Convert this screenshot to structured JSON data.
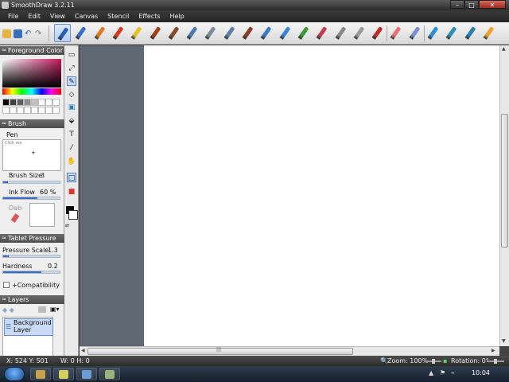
{
  "window": {
    "title": "SmoothDraw 3.2.11",
    "controls": {
      "minimize": "–",
      "maximize": "□",
      "close": "✕"
    }
  },
  "menu": [
    "File",
    "Edit",
    "View",
    "Canvas",
    "Stencil",
    "Effects",
    "Help"
  ],
  "toolbar": {
    "small_icons": [
      "open-icon",
      "save-icon",
      "undo-icon",
      "redo-icon"
    ],
    "brushes": [
      {
        "name": "pen-tool",
        "color": "#2a5fb3",
        "active": true
      },
      {
        "name": "pencil-tool",
        "color": "#3d6fc7"
      },
      {
        "name": "crayon-tool",
        "color": "#e07a20"
      },
      {
        "name": "marker-tool",
        "color": "#d83a1d"
      },
      {
        "name": "highlighter-tool",
        "color": "#e5c224"
      },
      {
        "name": "brush-tool",
        "color": "#a53f1a"
      },
      {
        "name": "paint-brush-tool",
        "color": "#8a4a23"
      },
      {
        "name": "airbrush-tool",
        "color": "#4f79b2"
      },
      {
        "name": "spray-tool",
        "color": "#7c8c9d"
      },
      {
        "name": "syringe-tool",
        "color": "#5e7fa8"
      },
      {
        "name": "ink-brush-tool",
        "color": "#8c3a2c"
      },
      {
        "name": "water-brush-tool",
        "color": "#3a7cc8"
      },
      {
        "name": "blur-tool",
        "color": "#3b86d6"
      },
      {
        "name": "grass-tool",
        "color": "#3c9a34"
      },
      {
        "name": "jigsaw-tool",
        "color": "#c04050"
      },
      {
        "name": "texture-tool",
        "color": "#8b8b8b"
      },
      {
        "name": "hatch-tool",
        "color": "#9a9a9a"
      },
      {
        "name": "stamp-tool",
        "color": "#c62828"
      },
      {
        "name": "eraser-tool",
        "color": "#e57373"
      },
      {
        "name": "soft-eraser-tool",
        "color": "#7a8fd0"
      },
      {
        "name": "water-drop-tool",
        "color": "#2f8be0"
      },
      {
        "name": "fill-tool",
        "color": "#2e8fb4"
      },
      {
        "name": "blend-tool",
        "color": "#2c7fb0"
      },
      {
        "name": "smudge-tool",
        "color": "#f0a030"
      }
    ]
  },
  "left_panel": {
    "foreground_color": {
      "title": "Foreground Color",
      "swatches_row1": [
        "#000000",
        "#404040",
        "#606060",
        "#909090",
        "#c0c0c0",
        "#ffffff",
        "#ffffff",
        "#ffffff"
      ],
      "swatches_row2": [
        "#ffffff",
        "#ffffff",
        "#ffffff",
        "#ffffff",
        "#ffffff",
        "#ffffff",
        "#ffffff",
        "#ffffff"
      ]
    },
    "brush": {
      "title": "Brush",
      "name": "Pen",
      "preview_hint": "Click me",
      "size_label": "Brush Size",
      "size_value": "3",
      "size_fraction": 0.08,
      "flow_label": "Ink Flow",
      "flow_value": "60 %",
      "flow_fraction": 0.6,
      "dab_label": "Dab"
    },
    "tablet_pressure": {
      "title": "Tablet Pressure",
      "scale_label": "Pressure Scale",
      "scale_value": "1.3",
      "scale_fraction": 0.1,
      "hardness_label": "Hardness",
      "hardness_value": "0.2",
      "hardness_fraction": 0.68,
      "compat_label": "+Compatibility"
    },
    "layers": {
      "title": "Layers",
      "items": [
        "Background\nLayer"
      ]
    }
  },
  "tools_column": [
    {
      "name": "select-rect-icon",
      "glyph": "▭"
    },
    {
      "name": "move-icon",
      "glyph": "⤢"
    },
    {
      "name": "brush-icon",
      "glyph": "✎",
      "active": true
    },
    {
      "name": "eraser-icon",
      "glyph": "◇"
    },
    {
      "name": "picture-icon",
      "glyph": "▣"
    },
    {
      "name": "fill-bucket-icon",
      "glyph": "⬙"
    },
    {
      "name": "text-icon",
      "glyph": "T"
    },
    {
      "name": "eyedropper-icon",
      "glyph": "⁄"
    },
    {
      "name": "hand-icon",
      "glyph": "✋"
    },
    {
      "name": "rect-frame-icon",
      "glyph": "□",
      "active": true
    },
    {
      "name": "red-frame-icon",
      "glyph": "■"
    }
  ],
  "status": {
    "coords": "X: 524 Y: 501",
    "size": "W: 0 H: 0",
    "zoom": "Zoom: 100%",
    "rotation": "Rotation: 0°",
    "zoom_fraction": 0.5,
    "rotation_fraction": 0.5
  },
  "taskbar": {
    "time": "10:04",
    "apps": [
      "#c6a34b",
      "#d0d060",
      "#6b9cd6",
      "#98b47a"
    ]
  }
}
